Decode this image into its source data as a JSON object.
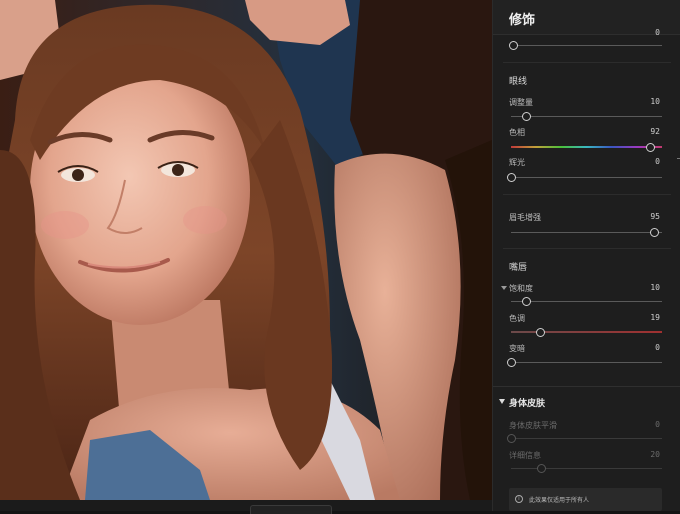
{
  "panel": {
    "title": "修饰",
    "top_partial_value": "0",
    "sections": {
      "eyeliner": {
        "title": "眼线",
        "rows": [
          {
            "label": "调整量",
            "value": "10",
            "level": 0.1
          },
          {
            "label": "色相",
            "value": "92",
            "level": 0.92
          },
          {
            "label": "辉光",
            "value": "0",
            "level": 0.0
          }
        ]
      },
      "lashes": {
        "rows": [
          {
            "label": "眉毛增强",
            "value": "95",
            "level": 0.95
          }
        ]
      },
      "lips": {
        "title": "嘴唇",
        "rows": [
          {
            "label": "饱和度",
            "value": "10",
            "level": 0.1
          },
          {
            "label": "色调",
            "value": "19",
            "level": 0.19
          },
          {
            "label": "变暗",
            "value": "0",
            "level": 0.0
          }
        ]
      },
      "body_skin": {
        "title": "身体皮肤",
        "rows": [
          {
            "label": "身体皮肤平滑",
            "value": "0",
            "level": 0.0
          },
          {
            "label": "详细信息",
            "value": "20",
            "level": 0.2
          }
        ]
      }
    },
    "notice": "此效果仅适用于所有人"
  },
  "colors": {
    "panel_bg": "#1e1e1e",
    "header_bg": "#222222",
    "text": "#c9c9c9"
  }
}
